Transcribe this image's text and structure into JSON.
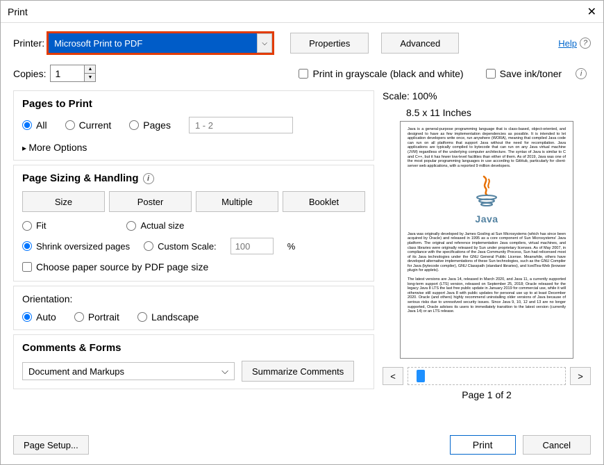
{
  "window": {
    "title": "Print"
  },
  "top": {
    "printer_label": "Printer:",
    "printer_value": "Microsoft Print to PDF",
    "properties_btn": "Properties",
    "advanced_btn": "Advanced",
    "help_link": "Help"
  },
  "copies": {
    "label": "Copies:",
    "value": "1",
    "grayscale_label": "Print in grayscale (black and white)",
    "save_ink_label": "Save ink/toner"
  },
  "pages": {
    "heading": "Pages to Print",
    "opt_all": "All",
    "opt_current": "Current",
    "opt_pages": "Pages",
    "range_placeholder": "1 - 2",
    "more_options": "More Options"
  },
  "sizing": {
    "heading": "Page Sizing & Handling",
    "btn_size": "Size",
    "btn_poster": "Poster",
    "btn_multiple": "Multiple",
    "btn_booklet": "Booklet",
    "opt_fit": "Fit",
    "opt_actual": "Actual size",
    "opt_shrink": "Shrink oversized pages",
    "opt_custom": "Custom Scale:",
    "custom_value": "100",
    "pct": "%",
    "choose_paper": "Choose paper source by PDF page size"
  },
  "orientation": {
    "label": "Orientation:",
    "opt_auto": "Auto",
    "opt_portrait": "Portrait",
    "opt_landscape": "Landscape"
  },
  "comments": {
    "heading": "Comments & Forms",
    "combo_value": "Document and Markups",
    "summarize_btn": "Summarize Comments"
  },
  "preview": {
    "scale_label": "Scale: 100%",
    "paper_label": "8.5 x 11 Inches",
    "page_label": "Page 1 of 2",
    "java_text": "Java",
    "para1": "Java is a general-purpose programming language that is class-based, object-oriented, and designed to have as few implementation dependencies as possible. It is intended to let application developers write once, run anywhere (WORA), meaning that compiled Java code can run on all platforms that support Java without the need for recompilation. Java applications are typically compiled to bytecode that can run on any Java virtual machine (JVM) regardless of the underlying computer architecture. The syntax of Java is similar to C and C++, but it has fewer low-level facilities than either of them. As of 2019, Java was one of the most popular programming languages in use according to GitHub, particularly for client-server web applications, with a reported 9 million developers.",
    "para2": "Java was originally developed by James Gosling at Sun Microsystems (which has since been acquired by Oracle) and released in 1995 as a core component of Sun Microsystems' Java platform. The original and reference implementation Java compilers, virtual machines, and class libraries were originally released by Sun under proprietary licenses. As of May 2007, in compliance with the specifications of the Java Community Process, Sun had relicensed most of its Java technologies under the GNU General Public License. Meanwhile, others have developed alternative implementations of these Sun technologies, such as the GNU Compiler for Java (bytecode compiler), GNU Classpath (standard libraries), and IcedTea-Web (browser plugin for applets).",
    "para3": "The latest versions are Java 14, released in March 2020, and Java 11, a currently supported long-term support (LTS) version, released on September 25, 2018; Oracle released for the legacy Java 8 LTS the last free public update in January 2019 for commercial use, while it will otherwise still support Java 8 with public updates for personal use up to at least December 2020. Oracle (and others) highly recommend uninstalling older versions of Java because of serious risks due to unresolved security issues. Since Java 9, 10, 12 and 13 are no longer supported, Oracle advises its users to immediately transition to the latest version (currently Java 14) or an LTS release."
  },
  "footer": {
    "page_setup": "Page Setup...",
    "print_btn": "Print",
    "cancel_btn": "Cancel"
  }
}
